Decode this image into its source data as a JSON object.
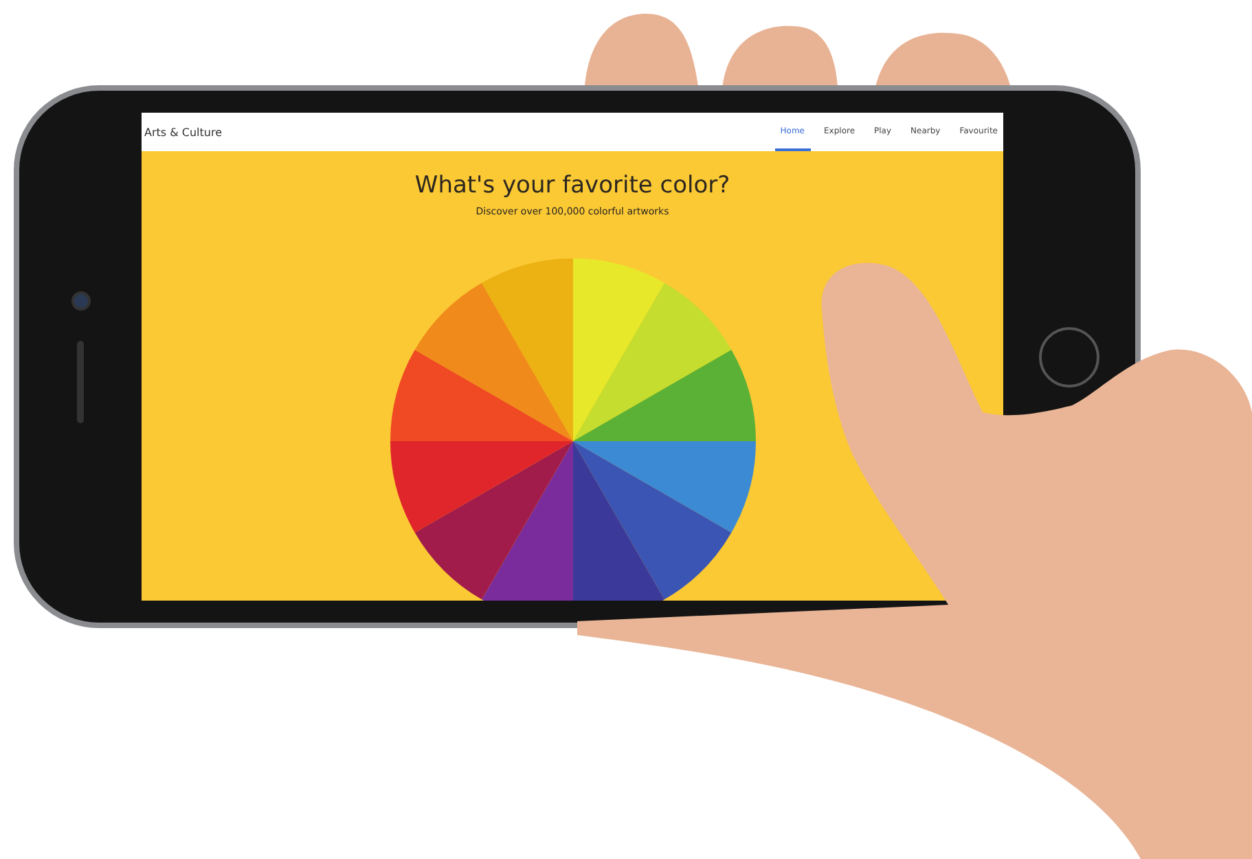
{
  "nav": {
    "title": "Arts & Culture",
    "tabs": [
      {
        "label": "Home",
        "selected": true
      },
      {
        "label": "Explore",
        "selected": false
      },
      {
        "label": "Play",
        "selected": false
      },
      {
        "label": "Nearby",
        "selected": false
      },
      {
        "label": "Favourite",
        "selected": false
      }
    ]
  },
  "hero": {
    "title": "What's your favorite color?",
    "subtitle": "Discover over 100,000 colorful artworks"
  }
}
